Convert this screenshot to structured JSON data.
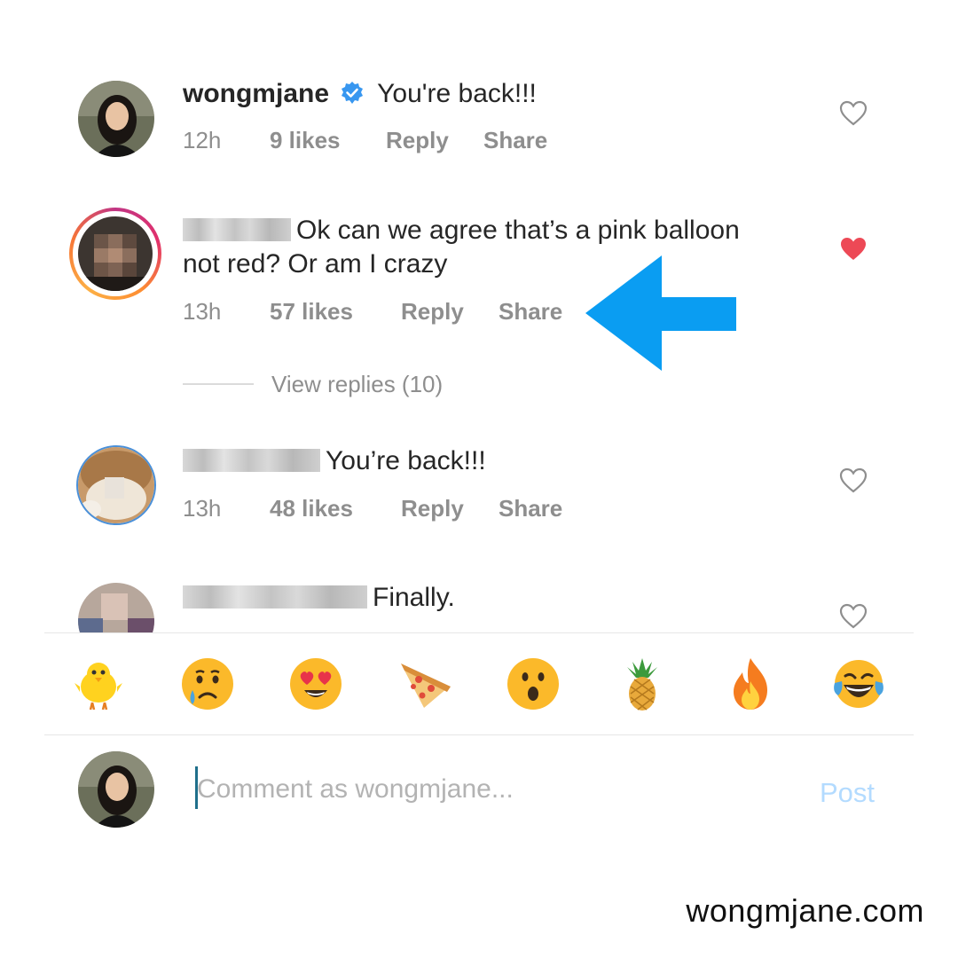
{
  "comments": [
    {
      "username": "wongmjane",
      "verified": true,
      "text": "You're back!!!",
      "time": "12h",
      "likes": "9 likes",
      "reply": "Reply",
      "share": "Share",
      "liked": false
    },
    {
      "username": "",
      "text_line1": "Ok can we agree that’s a pink balloon",
      "text_line2": "not red? Or am I crazy",
      "time": "13h",
      "likes": "57 likes",
      "reply": "Reply",
      "share": "Share",
      "liked": true,
      "view_replies": "View replies (10)"
    },
    {
      "username": "",
      "text": "You’re back!!!",
      "time": "13h",
      "likes": "48 likes",
      "reply": "Reply",
      "share": "Share",
      "liked": false
    },
    {
      "username": "",
      "text": "Finally.",
      "liked": false
    }
  ],
  "emoji_bar": [
    "chick-emoji",
    "crying-face-emoji",
    "heart-eyes-emoji",
    "pizza-emoji",
    "surprised-face-emoji",
    "pineapple-emoji",
    "fire-emoji",
    "laughing-tears-emoji"
  ],
  "composer": {
    "placeholder": "Comment as wongmjane...",
    "post_label": "Post"
  },
  "watermark": "wongmjane.com",
  "colors": {
    "liked_heart": "#ed4956",
    "arrow": "#0a9df2",
    "verified_badge": "#3897f0",
    "post_button": "#b3dbff"
  }
}
